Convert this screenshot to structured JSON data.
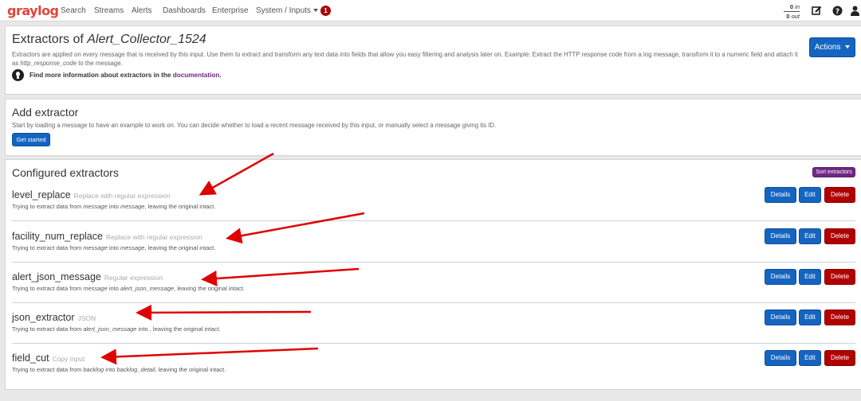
{
  "nav": {
    "logo": "graylog",
    "items": [
      "Search",
      "Streams",
      "Alerts",
      "Dashboards",
      "Enterprise",
      "System / Inputs"
    ],
    "notification_count": "1",
    "throughput_in": "0",
    "throughput_in_unit": "in",
    "throughput_out": "0",
    "throughput_out_unit": "out"
  },
  "header": {
    "title_prefix": "Extractors of ",
    "input_name": "Alert_Collector_1524",
    "description_1": "Extractors are applied on every message that is received by this input. Use them to extract and transform any text data into fields that allow you easy filtering and analysis later on. Example: Extract the HTTP response code from a log message, transform it to a numeric field and attach it as ",
    "description_field": "http_response_code",
    "description_2": " to the message.",
    "tip_text": "Find more information about extractors in the ",
    "tip_link": "documentation",
    "tip_end": ".",
    "actions_label": "Actions"
  },
  "add": {
    "title": "Add extractor",
    "description": "Start by loading a message to have an example to work on. You can decide whether to load a recent message received by this input, or manually select a message giving its ID.",
    "button": "Get started"
  },
  "configured": {
    "title": "Configured extractors",
    "sort_button": "Sort extractors",
    "details_label": "Details",
    "edit_label": "Edit",
    "delete_label": "Delete",
    "desc_prefix": "Trying to extract data from ",
    "desc_into": " into ",
    "desc_suffix": ", leaving the original intact.",
    "extractors": [
      {
        "name": "level_replace",
        "type": "Replace with regular expression",
        "source": "message",
        "target": "message"
      },
      {
        "name": "facility_num_replace",
        "type": "Replace with regular expression",
        "source": "message",
        "target": "message"
      },
      {
        "name": "alert_json_message",
        "type": "Regular expression",
        "source": "message",
        "target": "alert_json_message"
      },
      {
        "name": "json_extractor",
        "type": "JSON",
        "source": "alert_json_message",
        "target": ""
      },
      {
        "name": "field_cut",
        "type": "Copy input",
        "source": "backlog",
        "target": "backlog_detail"
      }
    ]
  },
  "colors": {
    "primary": "#1565c0",
    "danger": "#b00000",
    "purple": "#702785",
    "logo": "#e2443a",
    "annotation_arrow": "#e00000"
  }
}
